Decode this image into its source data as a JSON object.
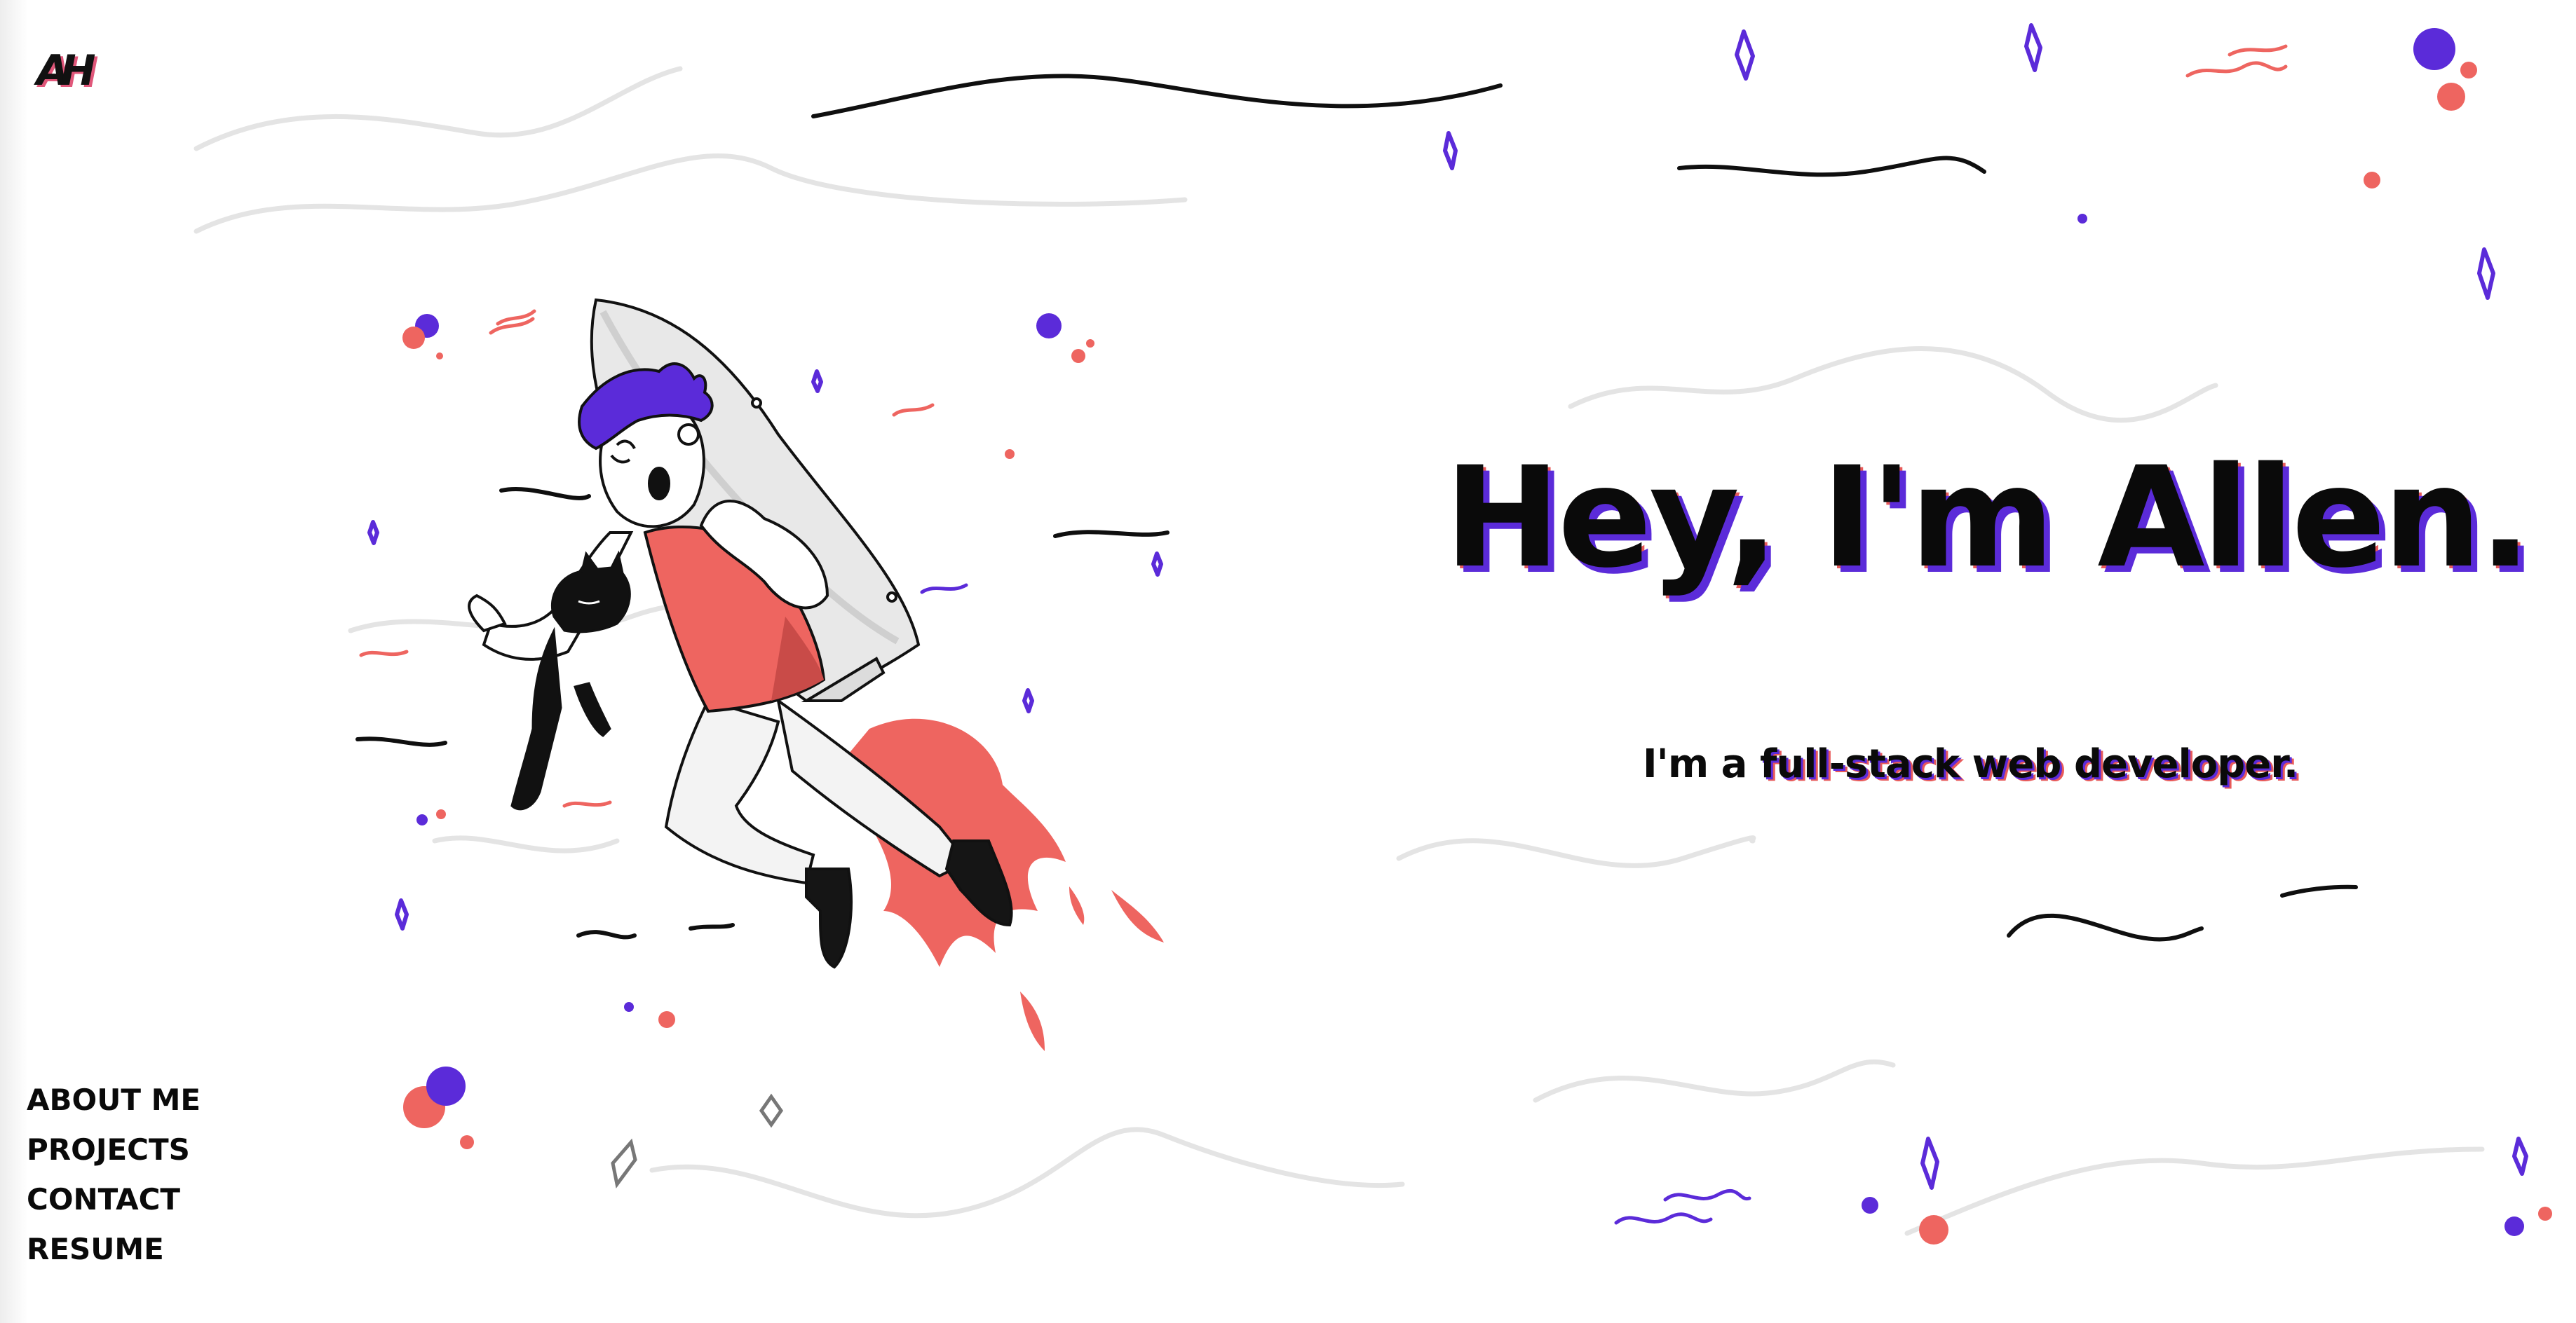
{
  "logo": {
    "text": "AH"
  },
  "hero": {
    "title": "Hey, I'm Allen.",
    "subtitle_prefix": "I'm a ",
    "subtitle_highlight": "full-stack web developer."
  },
  "nav": {
    "items": [
      {
        "label": "ABOUT ME"
      },
      {
        "label": "PROJECTS"
      },
      {
        "label": "CONTACT"
      },
      {
        "label": "RESUME"
      }
    ]
  },
  "colors": {
    "accent_purple": "#5b2bd9",
    "accent_coral": "#ee6560",
    "text": "#0a0a0a",
    "wave_light": "#e6e6e6"
  },
  "illustration": {
    "subject": "person-riding-rocket-holding-cat"
  }
}
